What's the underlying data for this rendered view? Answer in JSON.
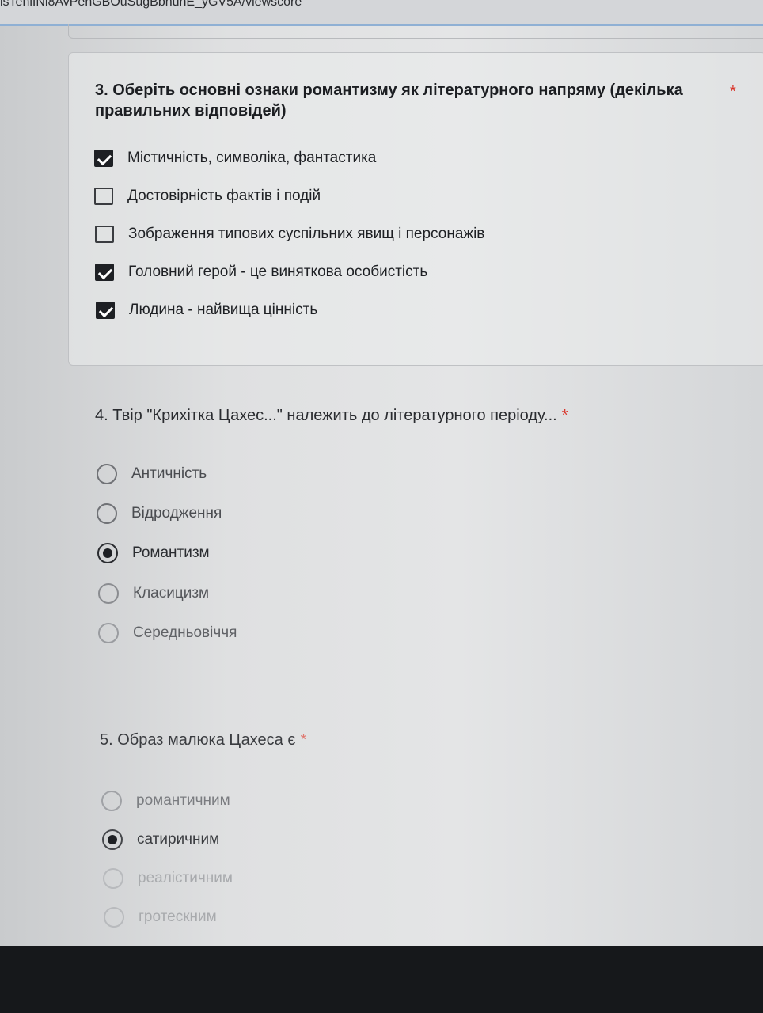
{
  "url_fragment": "isTehiINl8AvPehGBOuSugBbhunE_yGV5A/viewscore",
  "q3": {
    "title": "3. Оберіть основні ознаки романтизму як літературного напряму (декілька правильних відповідей)",
    "required": "*",
    "options": [
      {
        "label": "Містичність, символіка, фантастика",
        "checked": true
      },
      {
        "label": "Достовірність фактів і подій",
        "checked": false
      },
      {
        "label": "Зображення типових суспільних явищ і персонажів",
        "checked": false
      },
      {
        "label": "Головний герой - це виняткова особистість",
        "checked": true
      },
      {
        "label": "Людина - найвища цінність",
        "checked": true
      }
    ]
  },
  "q4": {
    "title": "4. Твір \"Крихітка Цахес...\" належить до літературного періоду...",
    "required": "*",
    "options": [
      {
        "label": "Античність",
        "checked": false
      },
      {
        "label": "Відродження",
        "checked": false
      },
      {
        "label": "Романтизм",
        "checked": true
      },
      {
        "label": "Класицизм",
        "checked": false
      },
      {
        "label": "Середньовіччя",
        "checked": false
      }
    ]
  },
  "q5": {
    "title": "5. Образ малюка Цахеса є",
    "required": "*",
    "options": [
      {
        "label": "романтичним",
        "checked": false
      },
      {
        "label": "сатиричним",
        "checked": true
      },
      {
        "label": "реалістичним",
        "checked": false
      },
      {
        "label": "гротескним",
        "checked": false
      }
    ]
  }
}
